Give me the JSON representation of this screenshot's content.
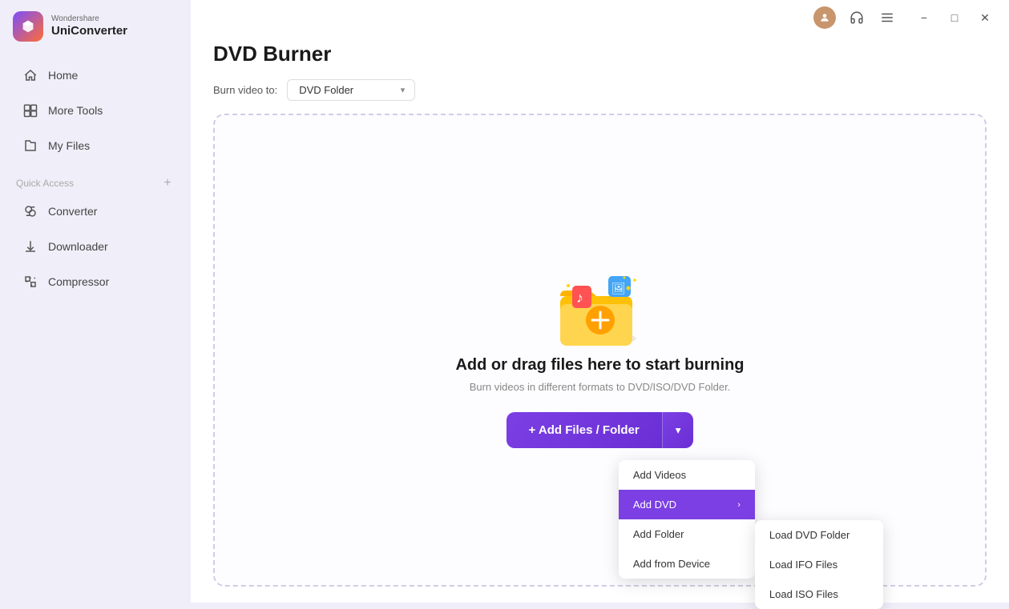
{
  "app": {
    "brand": "Wondershare",
    "name": "UniConverter"
  },
  "titlebar": {
    "icons": [
      "user",
      "headphones",
      "menu"
    ],
    "window_controls": [
      "minimize",
      "maximize",
      "close"
    ]
  },
  "sidebar": {
    "nav_items": [
      {
        "id": "home",
        "label": "Home",
        "icon": "home-icon"
      },
      {
        "id": "more-tools",
        "label": "More Tools",
        "icon": "tools-icon"
      },
      {
        "id": "my-files",
        "label": "My Files",
        "icon": "files-icon"
      }
    ],
    "quick_access": {
      "label": "Quick Access",
      "add_tooltip": "Add"
    },
    "quick_access_items": [
      {
        "id": "converter",
        "label": "Converter",
        "icon": "converter-icon"
      },
      {
        "id": "downloader",
        "label": "Downloader",
        "icon": "downloader-icon"
      },
      {
        "id": "compressor",
        "label": "Compressor",
        "icon": "compressor-icon"
      }
    ]
  },
  "page": {
    "title": "DVD Burner",
    "burn_to_label": "Burn video to:",
    "burn_to_value": "DVD Folder",
    "drop_zone": {
      "heading": "Add or drag files here to start burning",
      "subtext": "Burn videos in different formats to DVD/ISO/DVD Folder."
    },
    "add_button": {
      "main_label": "+ Add Files / Folder",
      "dropdown_icon": "▾"
    },
    "dropdown_menu": {
      "items": [
        {
          "id": "add-videos",
          "label": "Add Videos",
          "has_submenu": false,
          "active": false
        },
        {
          "id": "add-dvd",
          "label": "Add DVD",
          "has_submenu": true,
          "active": true
        },
        {
          "id": "add-folder",
          "label": "Add Folder",
          "has_submenu": false,
          "active": false
        },
        {
          "id": "add-from-device",
          "label": "Add from Device",
          "has_submenu": false,
          "active": false
        }
      ],
      "submenu_items": [
        {
          "id": "load-dvd-folder",
          "label": "Load DVD Folder"
        },
        {
          "id": "load-ifo-files",
          "label": "Load IFO Files"
        },
        {
          "id": "load-iso-files",
          "label": "Load ISO Files"
        }
      ]
    }
  }
}
